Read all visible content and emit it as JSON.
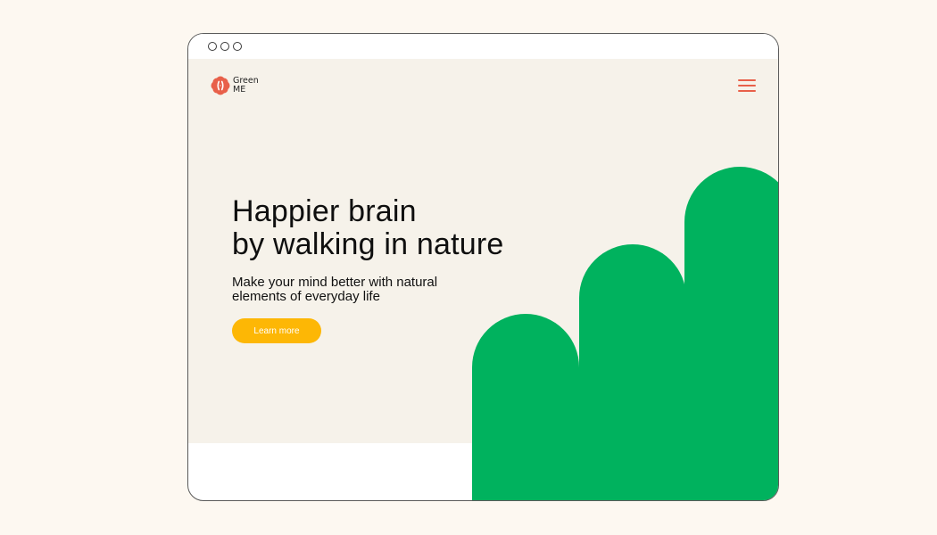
{
  "brand": {
    "name_line1": "Green",
    "name_line2": "ME",
    "logo_color": "#e8604a"
  },
  "header": {
    "menu_icon": "hamburger-menu-icon",
    "menu_color": "#e8604a"
  },
  "hero": {
    "headline_line1": "Happier brain",
    "headline_line2": "by walking in nature",
    "subtitle_line1": "Make your mind better with natural",
    "subtitle_line2": "elements of everyday life",
    "cta_label": "Learn more",
    "cta_color": "#fdb705",
    "background_color": "#f6f2ea"
  },
  "decoration": {
    "shape_color": "#00b25e"
  },
  "window": {
    "controls": [
      "circle",
      "circle",
      "circle"
    ]
  }
}
